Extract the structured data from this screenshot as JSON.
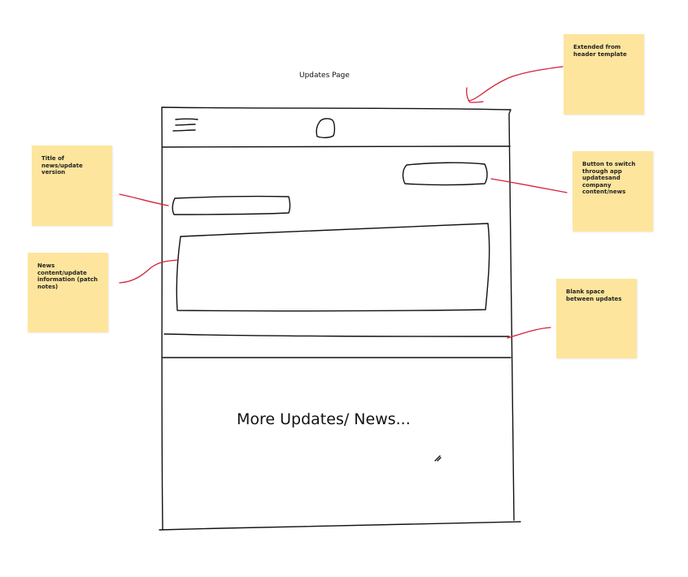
{
  "page_title": "Updates Page",
  "more_text": "More Updates/ News...",
  "notes": {
    "title_note": "Title of news/update version",
    "content_note": "News content/update information (patch notes)",
    "header_note": "Extended from header template",
    "switch_button_note": "Button to switch through app updatesand company content/news",
    "blank_space_note": "Blank space between updates"
  },
  "icons": {
    "menu": "hamburger-menu-icon",
    "logo": "logo-icon"
  },
  "colors": {
    "sticky_note": "#fde59d",
    "annotation_arrow": "#d6203a",
    "sketch_line": "#111111"
  }
}
